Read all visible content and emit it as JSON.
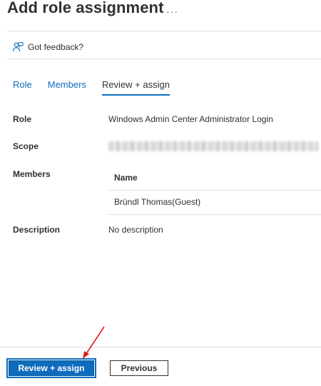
{
  "header": {
    "title": "Add role assignment",
    "more_label": "···"
  },
  "feedback": {
    "label": "Got feedback?"
  },
  "tabs": [
    {
      "label": "Role",
      "active": false
    },
    {
      "label": "Members",
      "active": false
    },
    {
      "label": "Review + assign",
      "active": true
    }
  ],
  "details": {
    "role_label": "Role",
    "role_value": "Windows Admin Center Administrator Login",
    "scope_label": "Scope",
    "members_label": "Members",
    "members_table": {
      "column_name": "Name",
      "rows": [
        "Bründl Thomas(Guest)"
      ]
    },
    "description_label": "Description",
    "description_value": "No description"
  },
  "footer": {
    "primary_label": "Review + assign",
    "secondary_label": "Previous"
  },
  "colors": {
    "accent": "#0f6cbd",
    "annotation_arrow": "#e02020"
  }
}
